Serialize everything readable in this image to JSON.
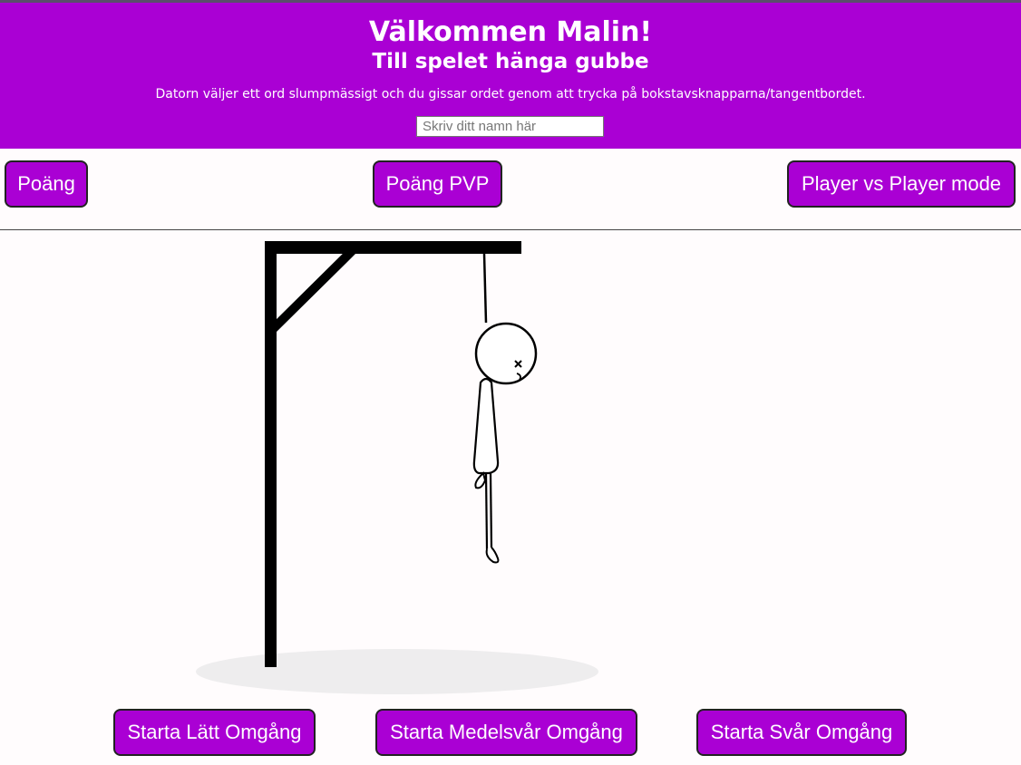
{
  "header": {
    "title": "Välkommen Malin!",
    "subtitle": "Till spelet hänga gubbe",
    "description": "Datorn väljer ett ord slumpmässigt och du gissar ordet genom att trycka på bokstavsknapparna/tangentbordet.",
    "name_input": {
      "placeholder": "Skriv ditt namn här",
      "value": ""
    }
  },
  "toolbar": {
    "score_label": "Poäng",
    "score_pvp_label": "Poäng PVP",
    "pvp_mode_label": "Player vs Player mode"
  },
  "game": {
    "hangman_stage": "complete",
    "face": "dead-x-eye"
  },
  "controls": {
    "easy_label": "Starta Lätt Omgång",
    "medium_label": "Starta Medelsvår Omgång",
    "hard_label": "Starta Svår Omgång"
  },
  "colors": {
    "accent": "#aa00d4",
    "header_text": "#ffffff",
    "button_border": "#222222",
    "background": "#fffcfd",
    "ground_shadow": "#eeedee"
  }
}
